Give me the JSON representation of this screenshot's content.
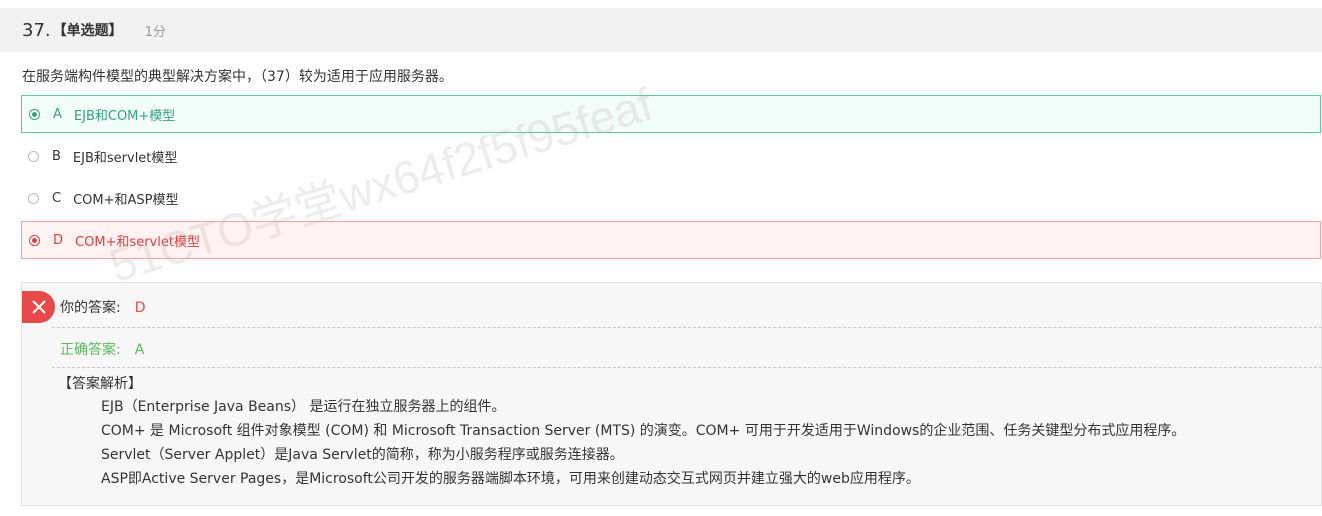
{
  "question": {
    "number": "37.",
    "type": "【单选题】",
    "score": "1分",
    "stem": "在服务端构件模型的典型解决方案中，（37）较为适用于应用服务器。"
  },
  "options": [
    {
      "letter": "A",
      "text": "EJB和COM+模型",
      "state": "correct"
    },
    {
      "letter": "B",
      "text": "EJB和servlet模型",
      "state": "normal"
    },
    {
      "letter": "C",
      "text": "COM+和ASP模型",
      "state": "normal"
    },
    {
      "letter": "D",
      "text": "COM+和servlet模型",
      "state": "wrong-selected"
    }
  ],
  "result": {
    "your_label": "你的答案:",
    "your_value": "D",
    "correct_label": "正确答案:",
    "correct_value": "A"
  },
  "analysis": {
    "title": "【答案解析】",
    "lines": [
      "EJB（Enterprise Java Beans） 是运行在独立服务器上的组件。",
      "COM+ 是 Microsoft 组件对象模型 (COM) 和 Microsoft Transaction Server (MTS) 的演变。COM+ 可用于开发适用于Windows的企业范围、任务关键型分布式应用程序。",
      "Servlet（Server Applet）是Java Servlet的简称，称为小服务程序或服务连接器。",
      "ASP即Active Server Pages，是Microsoft公司开发的服务器端脚本环境，可用来创建动态交互式网页并建立强大的web应用程序。"
    ]
  },
  "watermark": "51CTO学堂wx64f2f5f95feaf",
  "colors": {
    "correct": "#36a083",
    "wrong": "#e23d3d",
    "green_text": "#5cb85c",
    "badge": "#e84a4a"
  },
  "icons": {
    "wrong_badge": "close-icon"
  }
}
